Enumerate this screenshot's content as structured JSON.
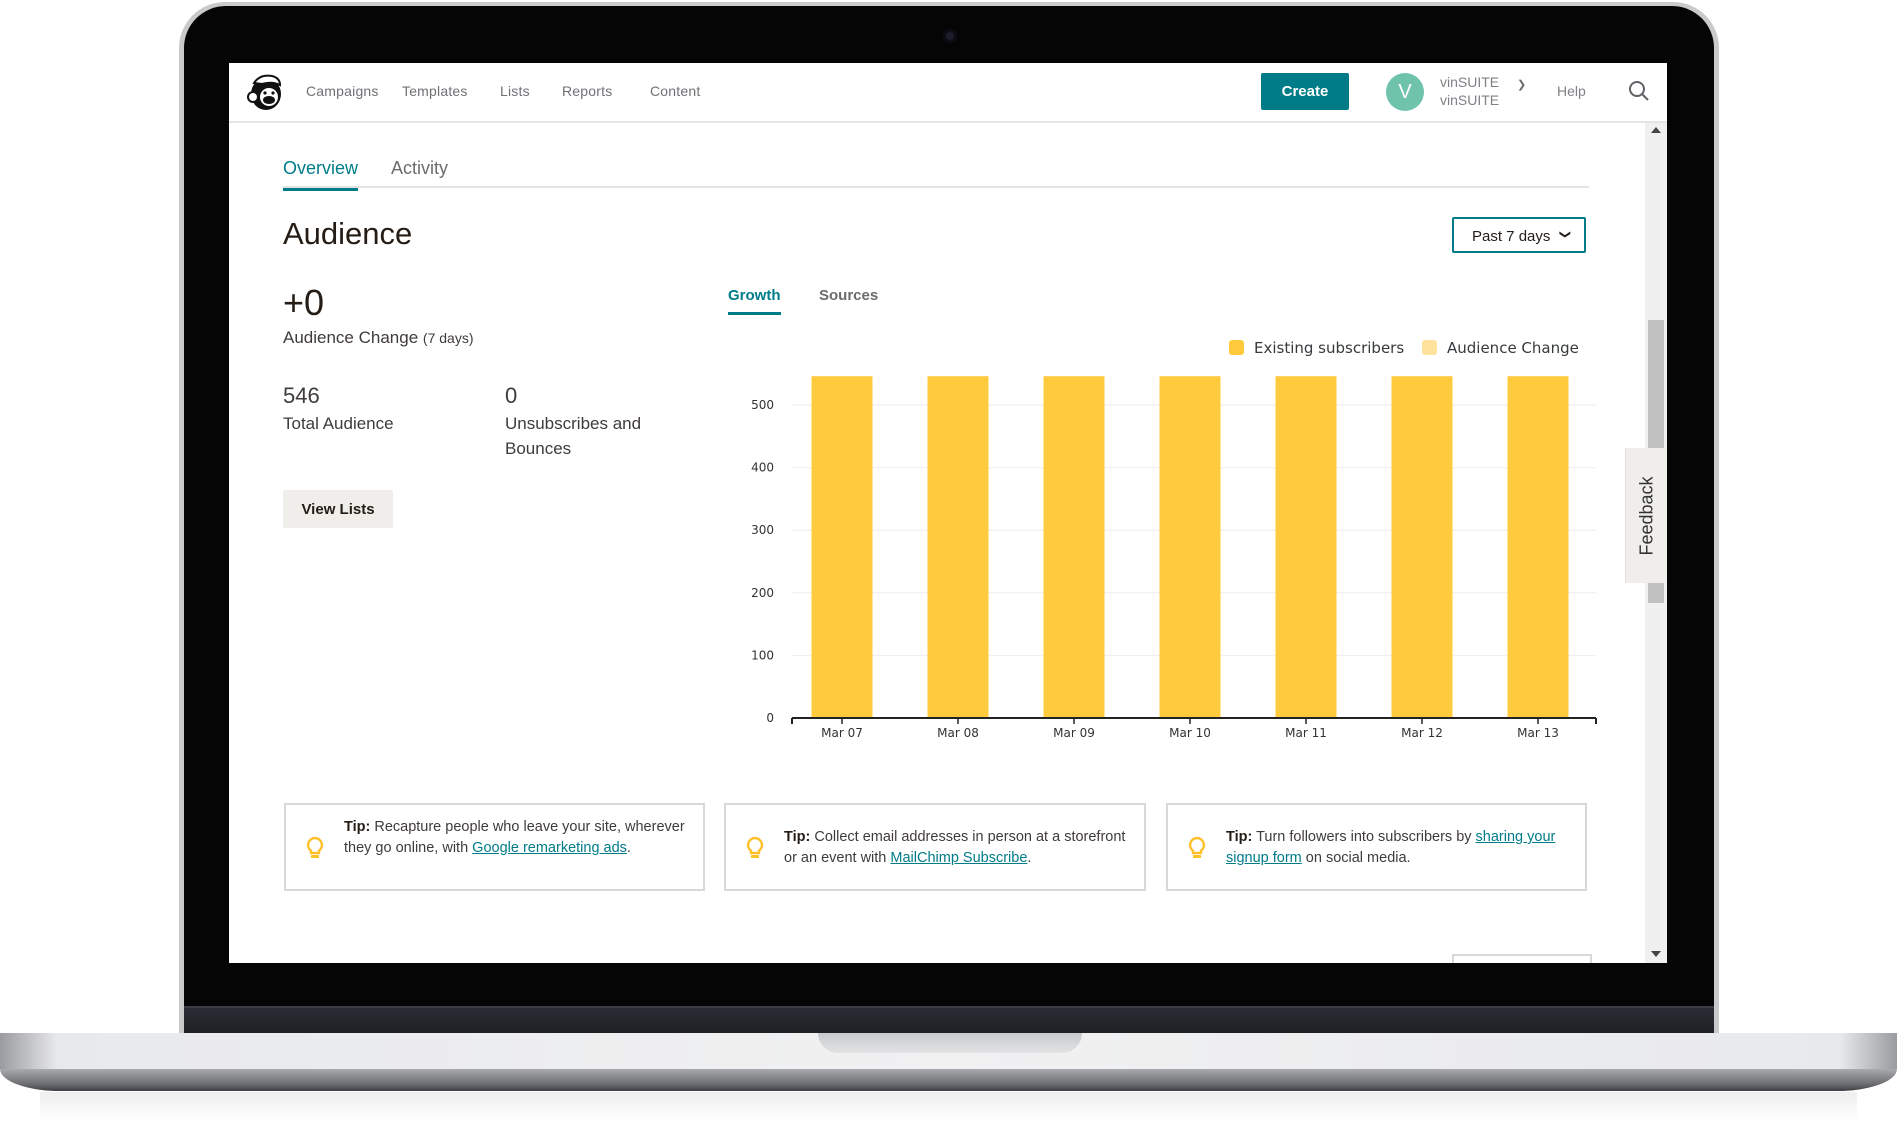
{
  "nav": {
    "logo": "mailchimp-freddie-logo",
    "items": [
      "Campaigns",
      "Templates",
      "Lists",
      "Reports",
      "Content"
    ],
    "create_label": "Create",
    "account": {
      "avatar_letter": "V",
      "name_line1": "vinSUITE",
      "name_line2": "vinSUITE"
    },
    "help_label": "Help",
    "search_icon": "search-icon"
  },
  "tabs": [
    {
      "label": "Overview",
      "active": true
    },
    {
      "label": "Activity",
      "active": false
    }
  ],
  "page": {
    "title": "Audience",
    "range_label": "Past 7 days",
    "audience_change_value": "+0",
    "audience_change_label": "Audience Change",
    "audience_change_period": "(7 days)",
    "total_audience_value": "546",
    "total_audience_label": "Total Audience",
    "unsubs_value": "0",
    "unsubs_label": "Unsubscribes and Bounces",
    "view_lists_label": "View Lists"
  },
  "chart_tabs": [
    {
      "label": "Growth",
      "active": true
    },
    {
      "label": "Sources",
      "active": false
    }
  ],
  "feedback_label": "Feedback",
  "colors": {
    "accent": "#007c89",
    "existing": "#ffcb3d",
    "change": "#ffe29b",
    "avatar": "#6fc3ab"
  },
  "chart_data": {
    "type": "bar",
    "title": "",
    "xlabel": "",
    "ylabel": "",
    "categories": [
      "Mar 07",
      "Mar 08",
      "Mar 09",
      "Mar 10",
      "Mar 11",
      "Mar 12",
      "Mar 13"
    ],
    "series": [
      {
        "name": "Existing subscribers",
        "values": [
          546,
          546,
          546,
          546,
          546,
          546,
          546
        ]
      },
      {
        "name": "Audience Change",
        "values": [
          0,
          0,
          0,
          0,
          0,
          0,
          0
        ]
      }
    ],
    "yticks": [
      0,
      100,
      200,
      300,
      400,
      500
    ],
    "ylim": [
      0,
      546
    ],
    "grid": true,
    "legend": "top-right",
    "stacked": true
  },
  "tips": [
    {
      "prefix": "Tip:",
      "before": " Recapture people who leave your site, wherever they go online, with ",
      "link": "Google remarketing ads",
      "after": "."
    },
    {
      "prefix": "Tip:",
      "before": " Collect email addresses in person at a storefront or an event with ",
      "link": "MailChimp Subscribe",
      "after": "."
    },
    {
      "prefix": "Tip:",
      "before": " Turn followers into subscribers by ",
      "link": "sharing your signup form",
      "after": " on social media."
    }
  ]
}
